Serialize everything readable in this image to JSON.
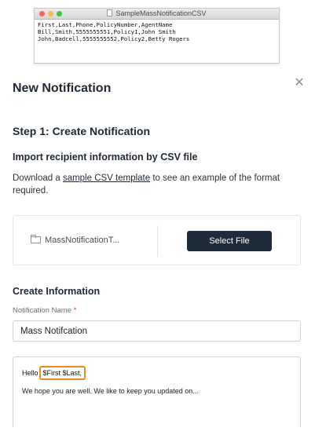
{
  "csv_preview": {
    "window_title": "SampleMassNotificationCSV",
    "lines": [
      "First,Last,Phone,PolicyNumber,AgentName",
      "Bill,Smith,5555555551,Policy1,John Smith",
      "John,Badcell,5555555552,Policy2,Betty Rogers"
    ]
  },
  "modal": {
    "title": "New Notification",
    "close_icon": "close-icon"
  },
  "step": {
    "title": "Step 1: Create Notification"
  },
  "import": {
    "title": "Import recipient information by CSV file",
    "desc_before": "Download a ",
    "desc_link": "sample CSV template",
    "desc_after": " to see an example of the format required.",
    "file_name": "MassNotificationT...",
    "select_file_label": "Select File"
  },
  "create_info": {
    "title": "Create Information",
    "name_label": "Notification Name",
    "required_marker": "*",
    "name_value": "Mass Notifcation",
    "message_greeting": "Hello",
    "message_tokens": "$First $Last",
    "message_punct": ",",
    "message_body": "We hope you are well. We like to keep you updated on..."
  },
  "colors": {
    "primary_button": "#1d2b3a",
    "highlight": "#f08a24",
    "required": "#e0322f"
  }
}
